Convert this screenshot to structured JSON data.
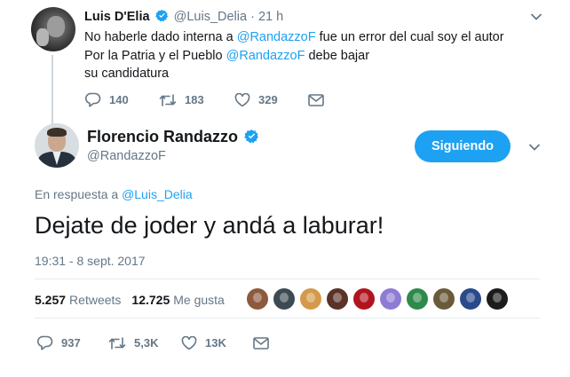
{
  "parent_tweet": {
    "name": "Luis D'Elia",
    "handle": "@Luis_Delia",
    "separator": "·",
    "time": "21 h",
    "text": {
      "line1_pre": "No haberle dado interna a ",
      "line1_mention": "@RandazzoF",
      "line1_post": " fue un error del cual soy el autor",
      "line2_pre": "Por la Patria y el Pueblo ",
      "line2_mention": "@RandazzoF",
      "line2_post": " debe bajar",
      "line3": "su candidatura"
    },
    "actions": {
      "replies": "140",
      "retweets": "183",
      "likes": "329"
    }
  },
  "main_tweet": {
    "name": "Florencio Randazzo",
    "handle": "@RandazzoF",
    "follow_button": "Siguiendo",
    "reply_to_prefix": "En respuesta a ",
    "reply_to_mention": "@Luis_Delia",
    "text": "Dejate de joder y andá a laburar!",
    "timestamp": "19:31 - 8 sept. 2017",
    "stats": {
      "retweets_count": "5.257",
      "retweets_label": "Retweets",
      "likes_count": "12.725",
      "likes_label": "Me gusta"
    },
    "liker_avatars": [
      "#8c5a3c",
      "#3d4a52",
      "#d49a4a",
      "#5a3328",
      "#b0141e",
      "#8e7bd6",
      "#2e8a4a",
      "#6a5a3a",
      "#2a4a8a",
      "#1c1c1c"
    ],
    "actions": {
      "replies": "937",
      "retweets": "5,3K",
      "likes": "13K"
    }
  },
  "colors": {
    "accent": "#1da1f2",
    "muted": "#657786",
    "text": "#14171a",
    "divider": "#e6ecf0"
  }
}
